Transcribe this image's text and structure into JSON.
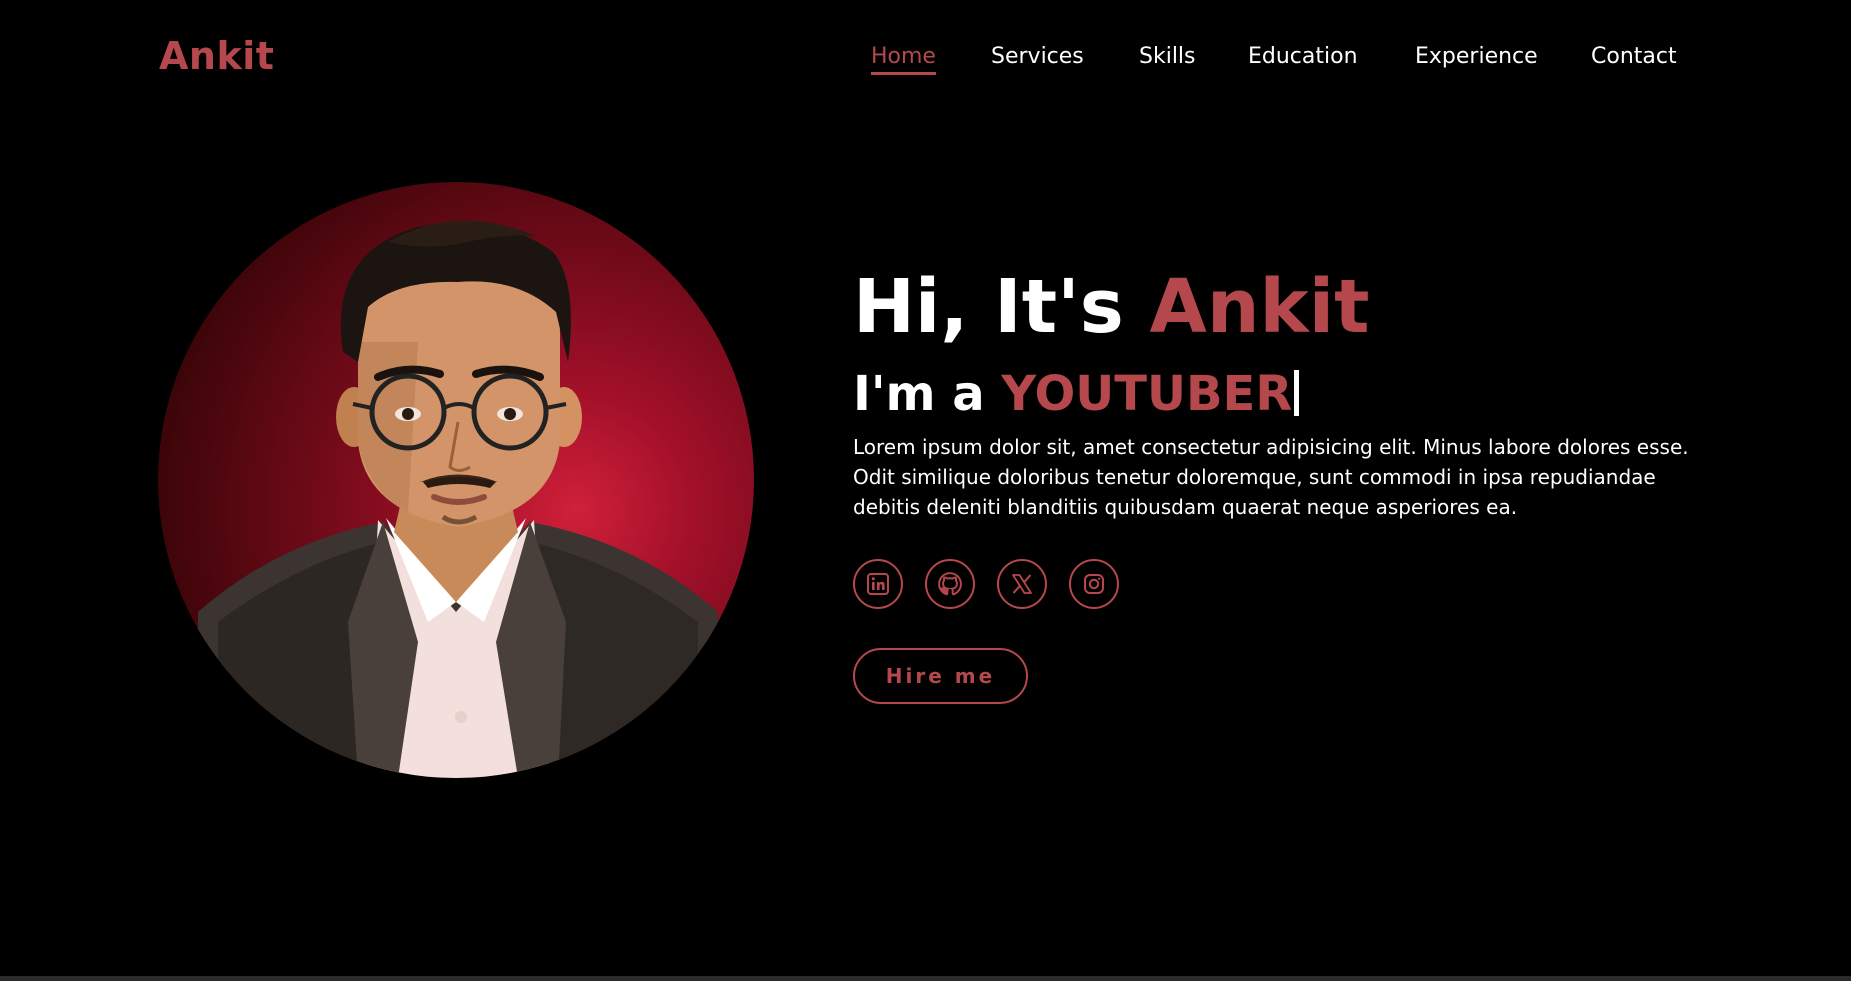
{
  "header": {
    "logo": "Ankit",
    "nav": [
      {
        "label": "Home",
        "active": true
      },
      {
        "label": "Services",
        "active": false
      },
      {
        "label": "Skills",
        "active": false
      },
      {
        "label": "Education",
        "active": false
      },
      {
        "label": "Experience",
        "active": false
      },
      {
        "label": "Contact",
        "active": false
      }
    ]
  },
  "hero": {
    "greeting": "Hi, It's ",
    "name": "Ankit",
    "role_prefix": "I'm a ",
    "role": "YOUTUBER",
    "description": "Lorem ipsum dolor sit, amet consectetur adipisicing elit. Minus labore dolores esse. Odit similique doloribus tenetur doloremque, sunt commodi in ipsa repudiandae debitis deleniti blanditiis quibusdam quaerat neque asperiores ea.",
    "socials": [
      {
        "icon": "linkedin-icon"
      },
      {
        "icon": "github-icon"
      },
      {
        "icon": "x-twitter-icon"
      },
      {
        "icon": "instagram-icon"
      }
    ],
    "cta_label": "Hire me"
  },
  "colors": {
    "accent": "#b5484d",
    "background": "#000000",
    "text": "#ffffff"
  }
}
